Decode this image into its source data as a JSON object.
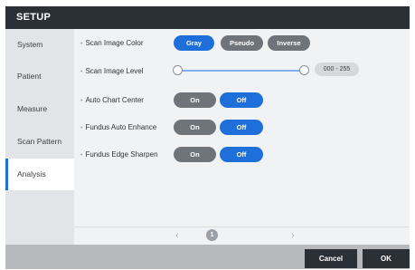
{
  "window": {
    "title": "SETUP"
  },
  "sidebar": {
    "items": [
      {
        "label": "System"
      },
      {
        "label": "Patient"
      },
      {
        "label": "Measure"
      },
      {
        "label": "Scan Pattern"
      },
      {
        "label": "Analysis"
      }
    ],
    "active": "Analysis"
  },
  "settings": {
    "bullet": "•",
    "scan_image_color": {
      "label": "Scan Image Color",
      "options": [
        "Gray",
        "Pseudo",
        "Inverse"
      ],
      "selected": "Gray"
    },
    "scan_image_level": {
      "label": "Scan Image Level",
      "range_text": "000 - 255",
      "min": 0,
      "max": 255
    },
    "auto_chart_center": {
      "label": "Auto Chart Center",
      "on_label": "On",
      "off_label": "Off",
      "selected": "Off"
    },
    "fundus_auto_enhance": {
      "label": "Fundus Auto Enhance",
      "on_label": "On",
      "off_label": "Off",
      "selected": "Off"
    },
    "fundus_edge_sharpen": {
      "label": "Fundus Edge Sharpen",
      "on_label": "On",
      "off_label": "Off",
      "selected": "Off"
    }
  },
  "pagination": {
    "prev": "‹",
    "current_page": "1",
    "next": "›"
  },
  "footer": {
    "cancel_label": "Cancel",
    "ok_label": "OK"
  },
  "colors": {
    "accent": "#1e6fd9",
    "titlebar": "#2b2f36",
    "unselected_pill": "#6f737a"
  }
}
